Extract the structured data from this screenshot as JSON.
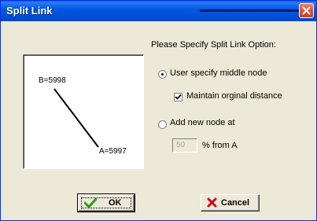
{
  "window": {
    "title": "Split Link"
  },
  "diagram": {
    "node_b_label": "B=5998",
    "node_a_label": "A=5997"
  },
  "options": {
    "heading": "Please Specify Split Link Option:",
    "radio_user_specify": {
      "label": "User specify middle node",
      "selected": true
    },
    "checkbox_maintain": {
      "label": "Maintain orginal distance",
      "checked": true
    },
    "radio_add_node": {
      "label": "Add new node at",
      "selected": false
    },
    "percent_value": "50",
    "percent_suffix": "% from A"
  },
  "buttons": {
    "ok_label": "OK",
    "cancel_label": "Cancel"
  },
  "icons": {
    "close": "close-icon",
    "ok": "checkmark-icon",
    "cancel": "x-icon"
  },
  "colors": {
    "titlebar": "#0058e2",
    "dialog_bg": "#ece9d8",
    "close_button": "#d95a3e",
    "ok_check": "#2a9d0f",
    "cancel_x": "#c8101a"
  }
}
